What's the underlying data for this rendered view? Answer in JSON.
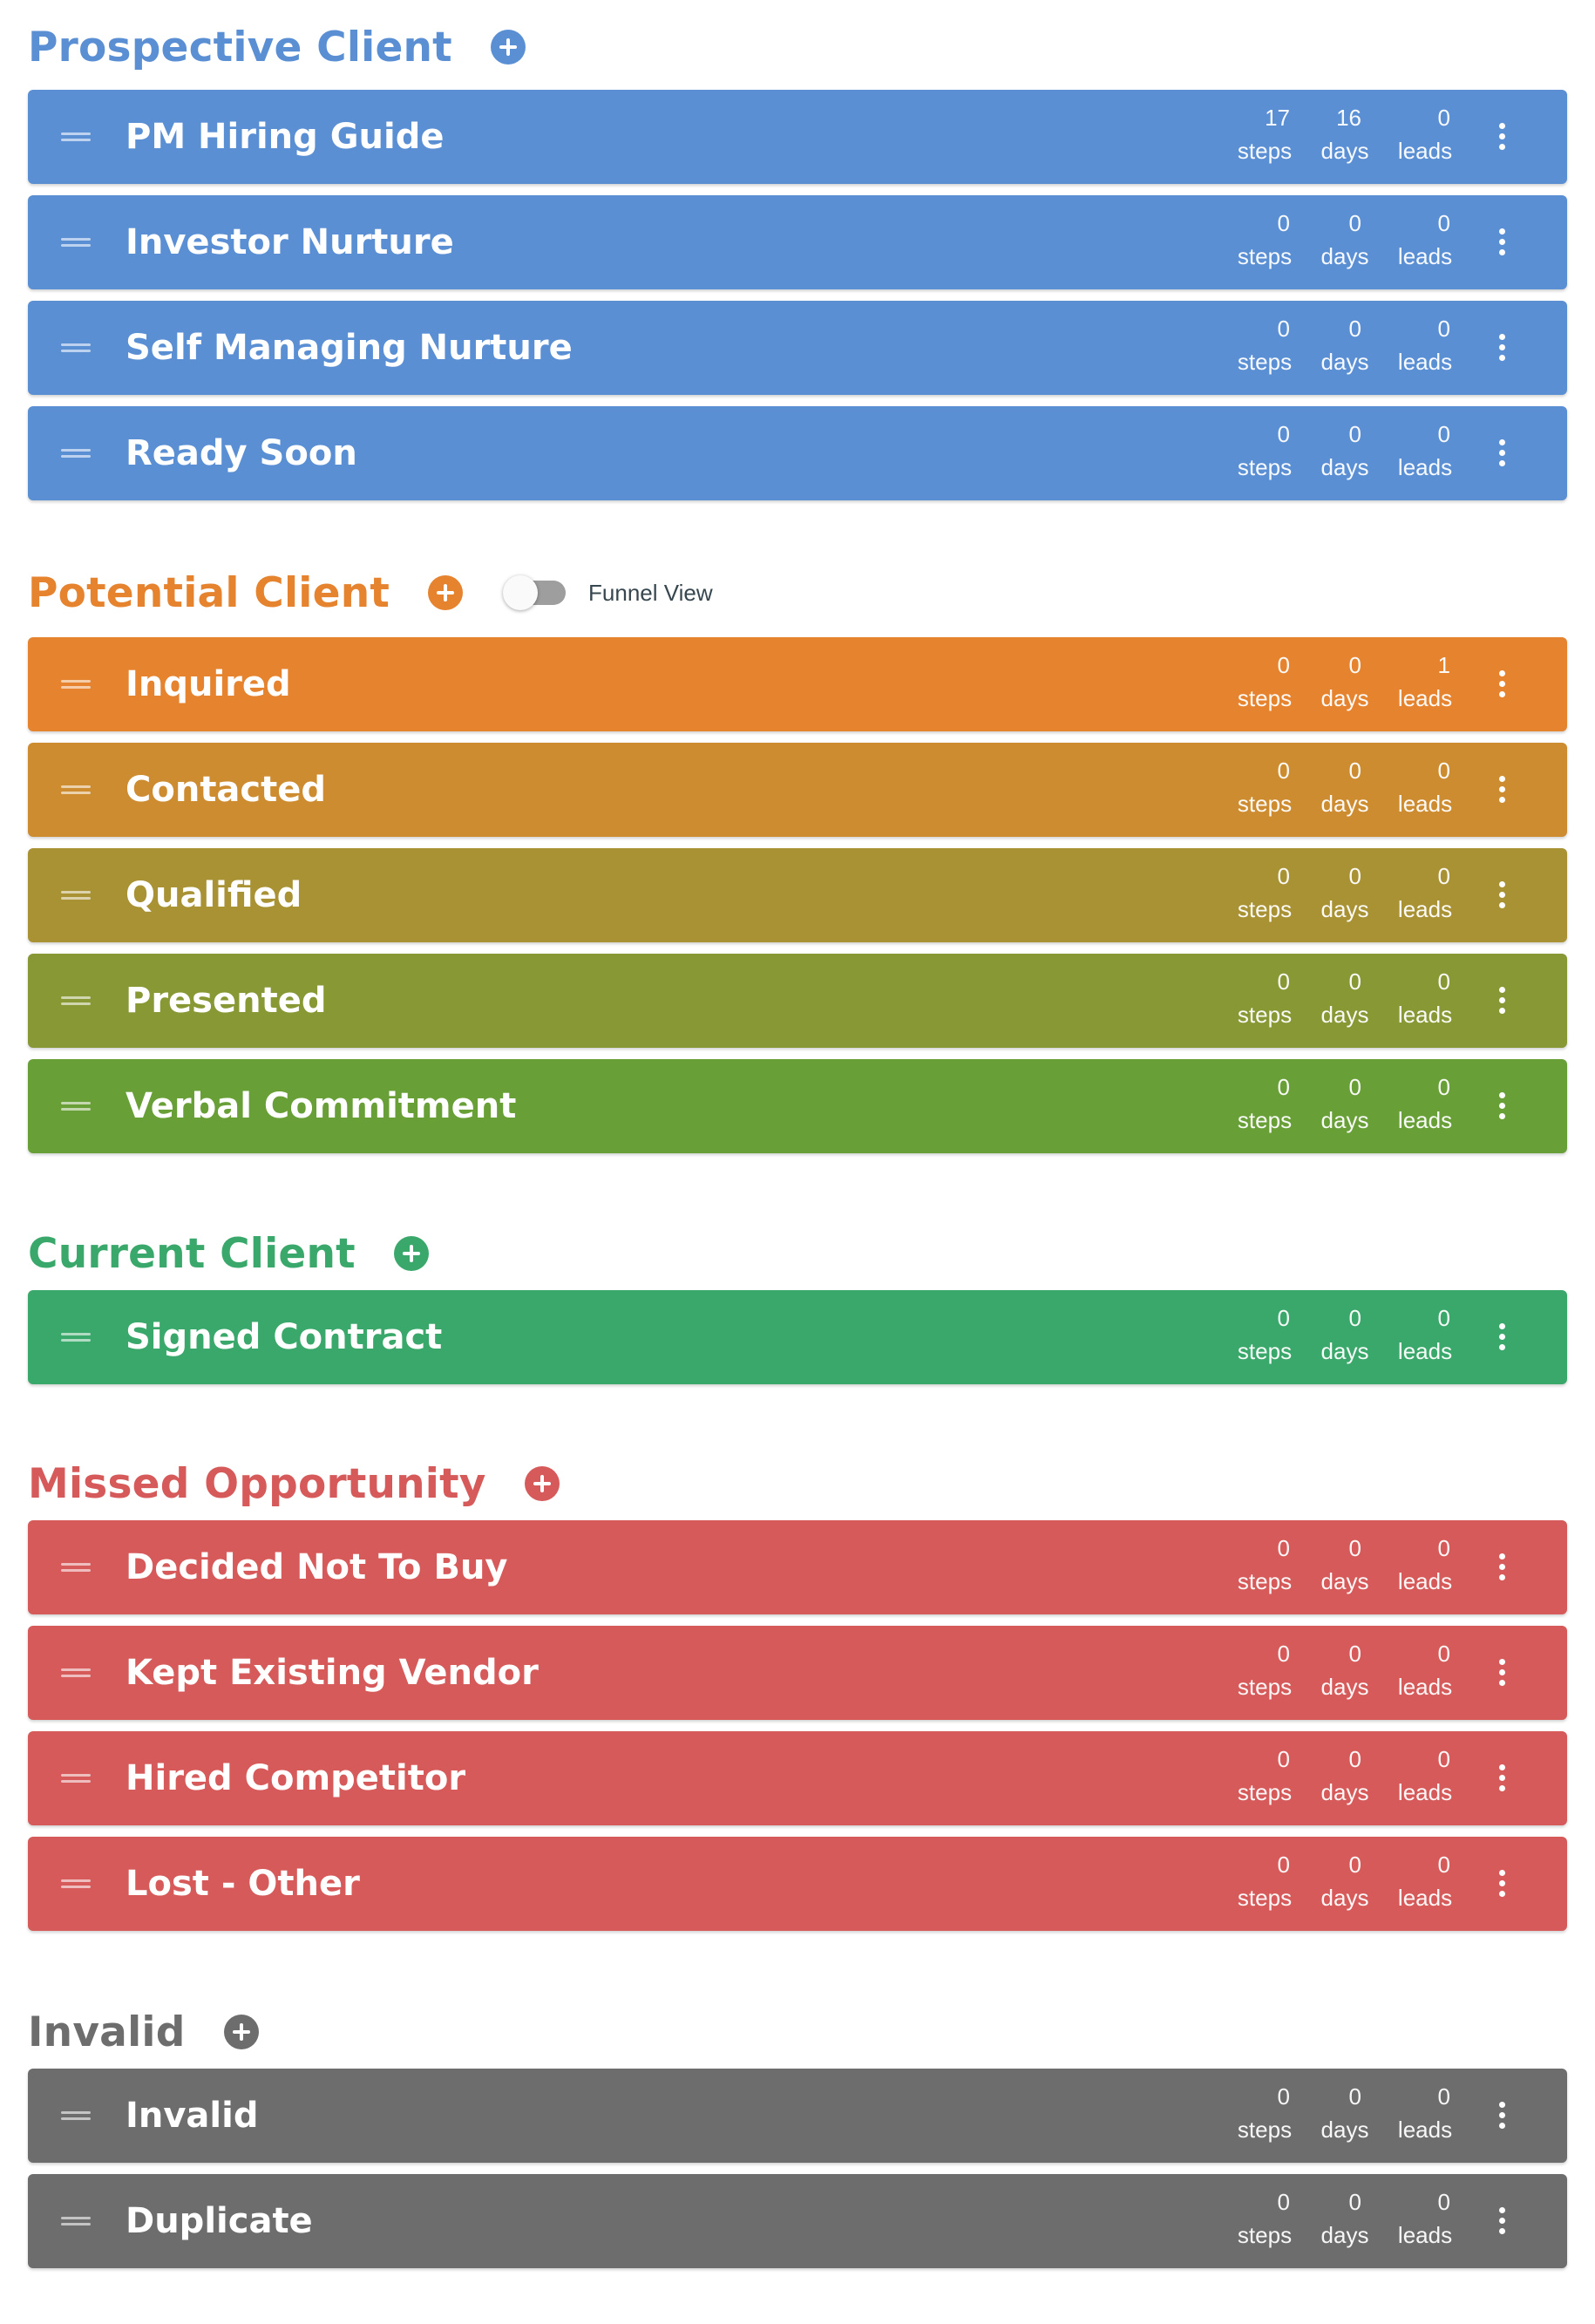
{
  "stat_labels": {
    "steps": "steps",
    "days": "days",
    "leads": "leads"
  },
  "funnel_view": {
    "label": "Funnel View",
    "enabled": false
  },
  "groups": [
    {
      "title": "Prospective Client",
      "color": "#5b8fd4",
      "title_color": "#5b8fd4",
      "add_icon": "plus-circle-icon",
      "stages": [
        {
          "name": "PM Hiring Guide",
          "steps": "17",
          "days": "16",
          "leads": "0",
          "color": "#5b8fd4"
        },
        {
          "name": "Investor Nurture",
          "steps": "0",
          "days": "0",
          "leads": "0",
          "color": "#5b8fd4"
        },
        {
          "name": "Self Managing Nurture",
          "steps": "0",
          "days": "0",
          "leads": "0",
          "color": "#5b8fd4"
        },
        {
          "name": "Ready Soon",
          "steps": "0",
          "days": "0",
          "leads": "0",
          "color": "#5b8fd4"
        }
      ]
    },
    {
      "title": "Potential Client",
      "color": "#e5832f",
      "title_color": "#e5832f",
      "add_icon": "plus-circle-icon",
      "has_funnel_toggle": true,
      "stages": [
        {
          "name": "Inquired",
          "steps": "0",
          "days": "0",
          "leads": "1",
          "color": "#e5832f"
        },
        {
          "name": "Contacted",
          "steps": "0",
          "days": "0",
          "leads": "0",
          "color": "#ce8c31"
        },
        {
          "name": "Qualified",
          "steps": "0",
          "days": "0",
          "leads": "0",
          "color": "#a99234"
        },
        {
          "name": "Presented",
          "steps": "0",
          "days": "0",
          "leads": "0",
          "color": "#879835"
        },
        {
          "name": "Verbal Commitment",
          "steps": "0",
          "days": "0",
          "leads": "0",
          "color": "#699f37"
        }
      ]
    },
    {
      "title": "Current Client",
      "color": "#3aa86a",
      "title_color": "#3aa86a",
      "add_icon": "plus-circle-icon",
      "stages": [
        {
          "name": "Signed Contract",
          "steps": "0",
          "days": "0",
          "leads": "0",
          "color": "#3aa86a"
        }
      ]
    },
    {
      "title": "Missed Opportunity",
      "color": "#d65a5a",
      "title_color": "#d65a5a",
      "add_icon": "plus-circle-icon",
      "stages": [
        {
          "name": "Decided Not To Buy",
          "steps": "0",
          "days": "0",
          "leads": "0",
          "color": "#d65a5a"
        },
        {
          "name": "Kept Existing Vendor",
          "steps": "0",
          "days": "0",
          "leads": "0",
          "color": "#d65a5a"
        },
        {
          "name": "Hired Competitor",
          "steps": "0",
          "days": "0",
          "leads": "0",
          "color": "#d65a5a"
        },
        {
          "name": "Lost - Other",
          "steps": "0",
          "days": "0",
          "leads": "0",
          "color": "#d65a5a"
        }
      ]
    },
    {
      "title": "Invalid",
      "color": "#6d6d6d",
      "title_color": "#6d6d6d",
      "add_icon": "plus-circle-icon",
      "stages": [
        {
          "name": "Invalid",
          "steps": "0",
          "days": "0",
          "leads": "0",
          "color": "#6d6d6d"
        },
        {
          "name": "Duplicate",
          "steps": "0",
          "days": "0",
          "leads": "0",
          "color": "#6d6d6d"
        }
      ]
    }
  ]
}
